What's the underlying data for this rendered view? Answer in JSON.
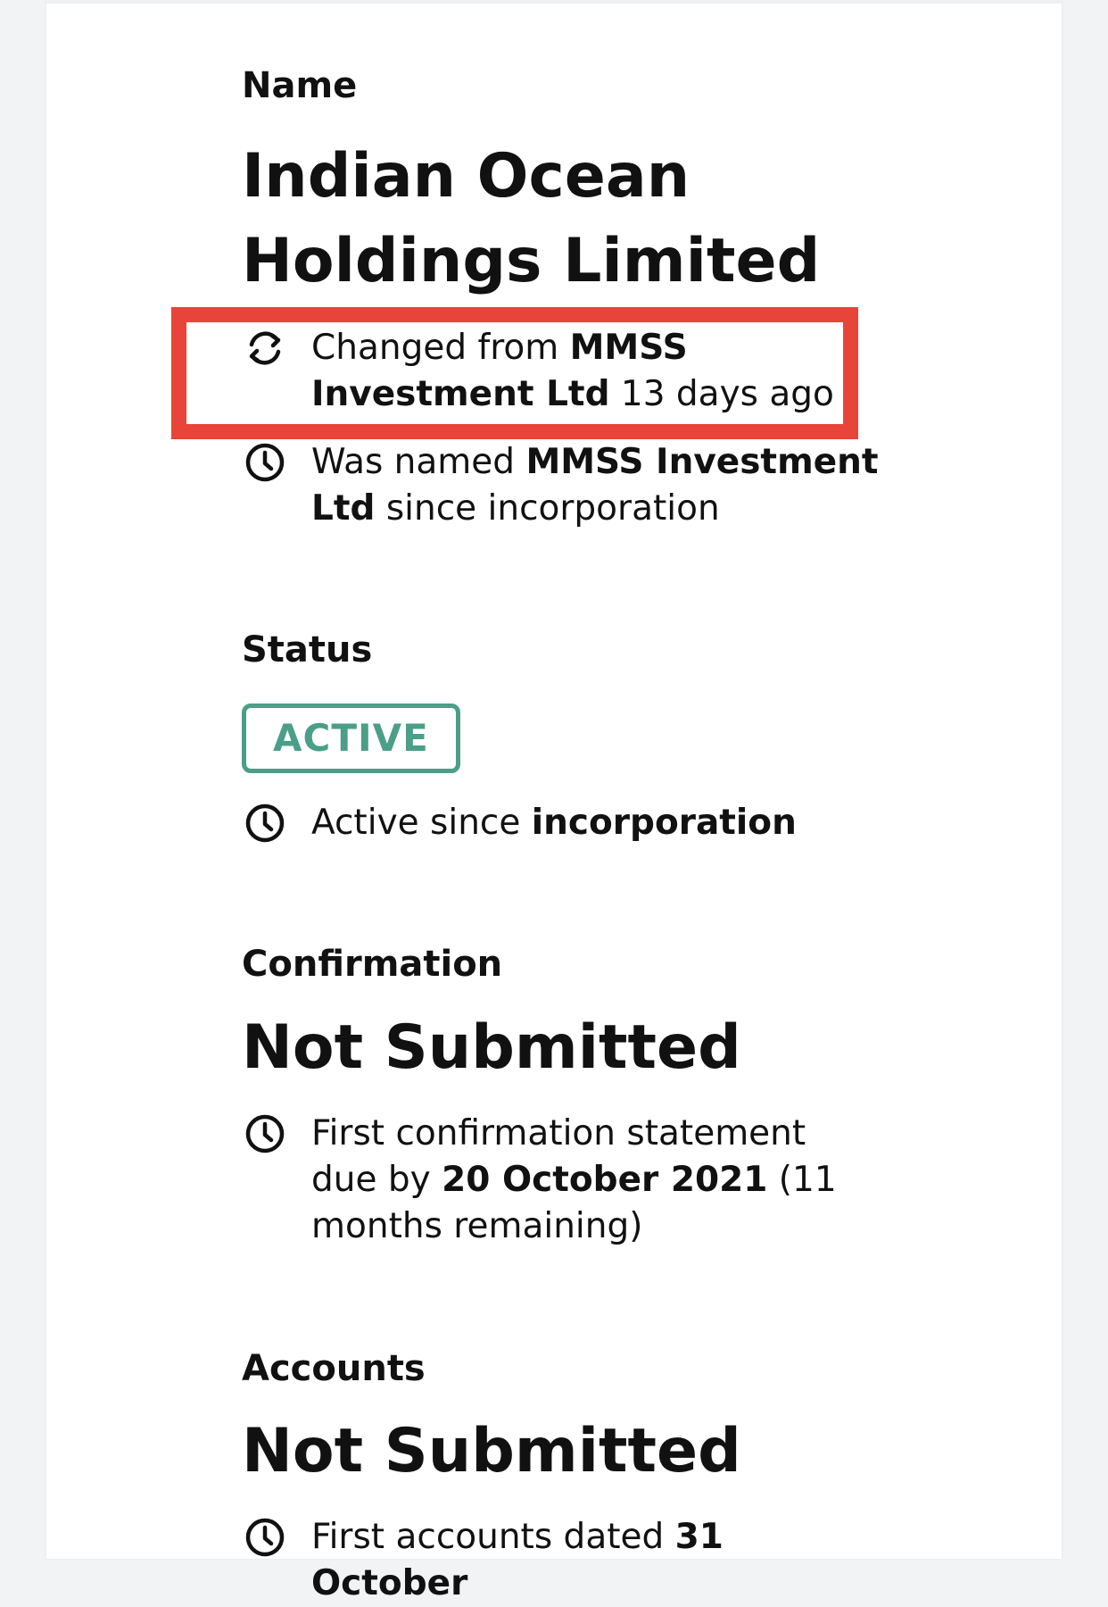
{
  "name_section": {
    "label": "Name",
    "company_name_line1": "Indian Ocean",
    "company_name_line2": "Holdings Limited",
    "change_note": {
      "icon": "refresh-icon",
      "prefix": "Changed from ",
      "old_name_part1": "MMSS",
      "old_name_part2": "Investment Ltd",
      "suffix": " 13 days ago"
    },
    "history_note": {
      "icon": "clock-icon",
      "prefix": "Was named ",
      "name_part1": "MMSS Investment",
      "name_part2": "Ltd",
      "suffix": " since incorporation"
    }
  },
  "status_section": {
    "label": "Status",
    "badge": "ACTIVE",
    "badge_color": "#4b9e88",
    "note": {
      "icon": "clock-icon",
      "prefix": "Active since ",
      "bold": "incorporation"
    }
  },
  "confirmation_section": {
    "label": "Confirmation",
    "value": "Not Submitted",
    "note": {
      "icon": "clock-icon",
      "line1": "First confirmation statement",
      "prefix2": "due by ",
      "date": "20 October 2021",
      "suffix2": " (11",
      "line3": "months remaining)"
    }
  },
  "accounts_section": {
    "label": "Accounts",
    "value": "Not Submitted",
    "note": {
      "icon": "clock-icon",
      "prefix": "First accounts dated ",
      "date_partial": "31 October"
    }
  },
  "highlight_color": "#e8443a"
}
